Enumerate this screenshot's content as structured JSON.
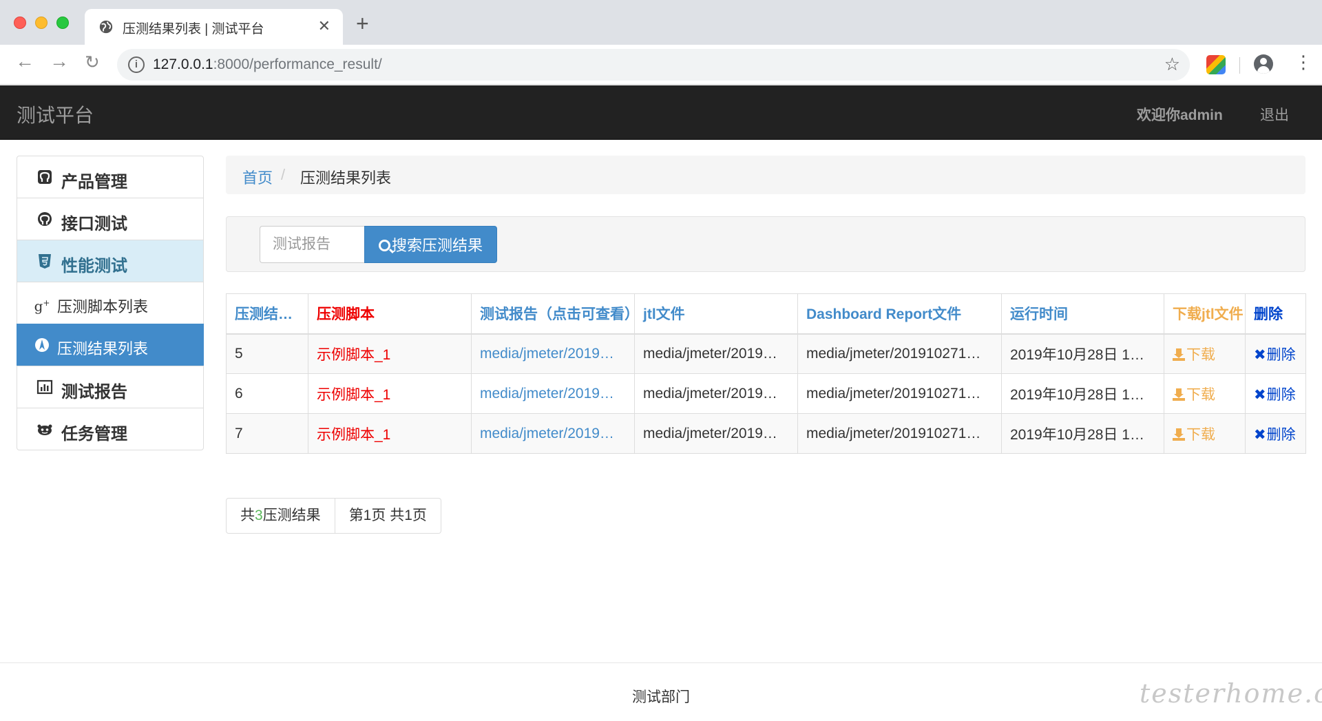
{
  "browser": {
    "tab_title": "压测结果列表 | 测试平台",
    "url_host": "127.0.0.1",
    "url_rest": ":8000/performance_result/"
  },
  "navbar": {
    "brand": "测试平台",
    "welcome": "欢迎你admin",
    "logout": "退出"
  },
  "sidebar": {
    "items": [
      {
        "label": "产品管理",
        "icon": "github-icon"
      },
      {
        "label": "接口测试",
        "icon": "github-alt-icon"
      },
      {
        "label": "性能测试",
        "icon": "html5-icon"
      },
      {
        "label": "压测脚本列表",
        "icon": "google-plus-icon"
      },
      {
        "label": "压测结果列表",
        "icon": "pied-piper-icon"
      },
      {
        "label": "测试报告",
        "icon": "bar-chart-icon"
      },
      {
        "label": "任务管理",
        "icon": "reddit-icon"
      }
    ]
  },
  "breadcrumb": {
    "home": "首页",
    "separator": "/",
    "current": "压测结果列表"
  },
  "search": {
    "placeholder": "测试报告",
    "button_label": "搜索压测结果"
  },
  "table": {
    "headers": {
      "id": "压测结果ID",
      "script": "压测脚本",
      "report": "测试报告（点击可查看）",
      "jtl": "jtl文件",
      "dashboard": "Dashboard Report文件",
      "run_time": "运行时间",
      "download": "下载jtl文件",
      "delete": "删除"
    },
    "rows": [
      {
        "id": "5",
        "script": "示例脚本_1",
        "report": "media/jmeter/2019…",
        "jtl": "media/jmeter/2019…",
        "dashboard": "media/jmeter/201910271…",
        "run_time": "2019年10月28日 1…",
        "download": "下载",
        "delete": "删除"
      },
      {
        "id": "6",
        "script": "示例脚本_1",
        "report": "media/jmeter/2019…",
        "jtl": "media/jmeter/2019…",
        "dashboard": "media/jmeter/201910271…",
        "run_time": "2019年10月28日 1…",
        "download": "下载",
        "delete": "删除"
      },
      {
        "id": "7",
        "script": "示例脚本_1",
        "report": "media/jmeter/2019…",
        "jtl": "media/jmeter/2019…",
        "dashboard": "media/jmeter/201910271…",
        "run_time": "2019年10月28日 1…",
        "download": "下载",
        "delete": "删除"
      }
    ]
  },
  "pagination": {
    "total_prefix": "共",
    "total_count": "3",
    "total_suffix": "压测结果",
    "page_info": "第1页 共1页"
  },
  "footer": {
    "text": "测试部门"
  },
  "watermark": "testerhome.com",
  "colors": {
    "navbar_bg": "#222222",
    "primary": "#428bca",
    "active_sidebar": "#428bca",
    "highlight_sidebar": "#d9edf7",
    "script_red": "#ee0000",
    "download_orange": "#f0ad4e",
    "delete_blue": "#0044cc",
    "count_green": "#5cb85c"
  }
}
